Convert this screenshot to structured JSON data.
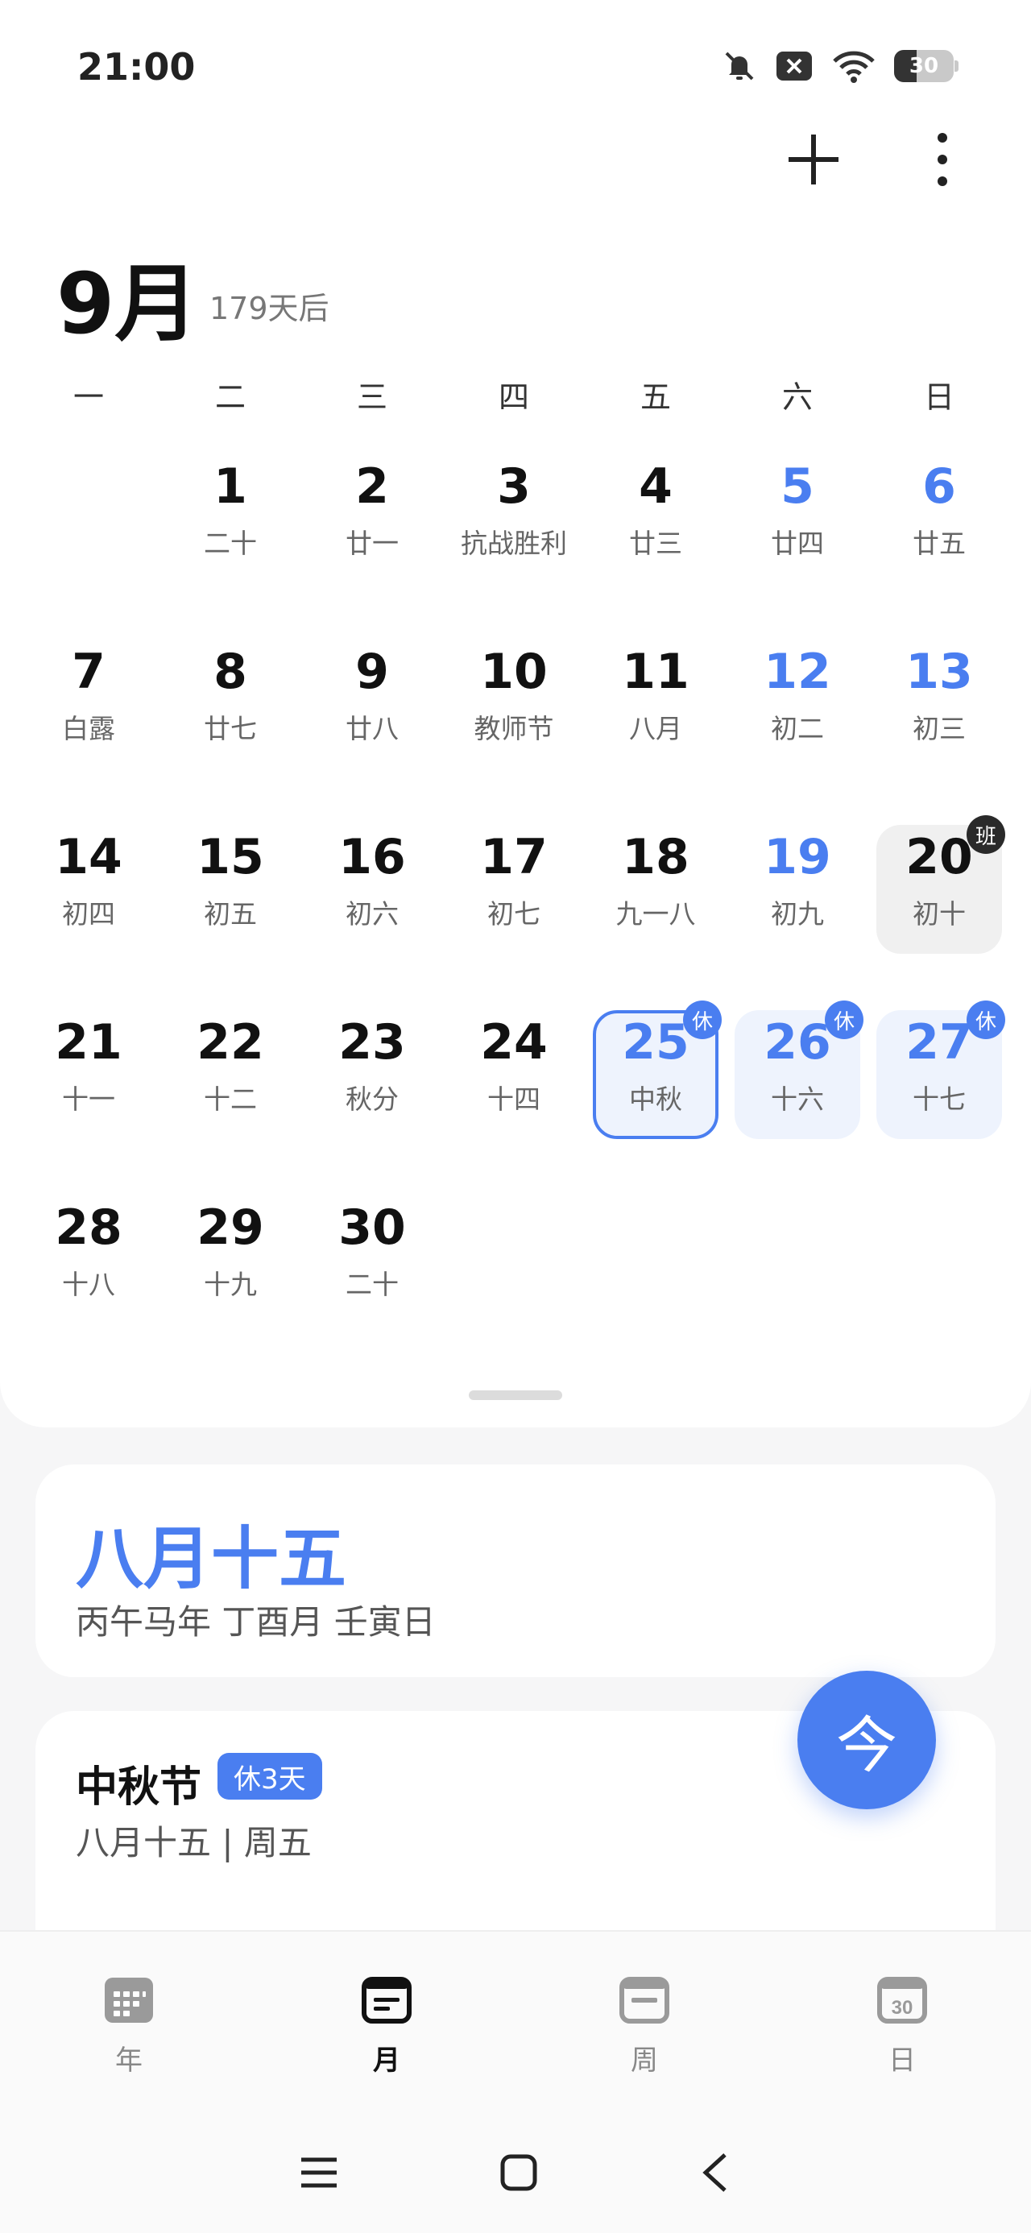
{
  "status": {
    "time": "21:00",
    "battery": "30"
  },
  "header": {
    "month": "9月",
    "days_later": "179天后"
  },
  "weekdays": [
    "一",
    "二",
    "三",
    "四",
    "五",
    "六",
    "日"
  ],
  "days": [
    {
      "n": "1",
      "l": "二十"
    },
    {
      "n": "2",
      "l": "廿一"
    },
    {
      "n": "3",
      "l": "抗战胜利"
    },
    {
      "n": "4",
      "l": "廿三"
    },
    {
      "n": "5",
      "l": "廿四"
    },
    {
      "n": "6",
      "l": "廿五"
    },
    {
      "n": "7",
      "l": "白露"
    },
    {
      "n": "8",
      "l": "廿七"
    },
    {
      "n": "9",
      "l": "廿八"
    },
    {
      "n": "10",
      "l": "教师节"
    },
    {
      "n": "11",
      "l": "八月"
    },
    {
      "n": "12",
      "l": "初二"
    },
    {
      "n": "13",
      "l": "初三"
    },
    {
      "n": "14",
      "l": "初四"
    },
    {
      "n": "15",
      "l": "初五"
    },
    {
      "n": "16",
      "l": "初六"
    },
    {
      "n": "17",
      "l": "初七"
    },
    {
      "n": "18",
      "l": "九一八"
    },
    {
      "n": "19",
      "l": "初九"
    },
    {
      "n": "20",
      "l": "初十",
      "badge": "班"
    },
    {
      "n": "21",
      "l": "十一"
    },
    {
      "n": "22",
      "l": "十二"
    },
    {
      "n": "23",
      "l": "秋分"
    },
    {
      "n": "24",
      "l": "十四"
    },
    {
      "n": "25",
      "l": "中秋",
      "badge": "休"
    },
    {
      "n": "26",
      "l": "十六",
      "badge": "休"
    },
    {
      "n": "27",
      "l": "十七",
      "badge": "休"
    },
    {
      "n": "28",
      "l": "十八"
    },
    {
      "n": "29",
      "l": "十九"
    },
    {
      "n": "30",
      "l": "二十"
    }
  ],
  "lunar_card": {
    "date": "八月十五",
    "ganzhi": "丙午马年 丁酉月 壬寅日"
  },
  "festival": {
    "name": "中秋节",
    "tag": "休3天",
    "when": "八月十五 | 周五"
  },
  "fab": {
    "label": "今"
  },
  "nav": [
    {
      "label": "年",
      "icon": "year-view-icon"
    },
    {
      "label": "月",
      "icon": "month-view-icon"
    },
    {
      "label": "周",
      "icon": "week-view-icon"
    },
    {
      "label": "日",
      "icon": "day-view-icon",
      "icon_text": "30"
    }
  ],
  "colors": {
    "accent": "#4a7ef0",
    "holiday_bg": "#eef3fd",
    "workday_badge": "#2a2a2a"
  }
}
